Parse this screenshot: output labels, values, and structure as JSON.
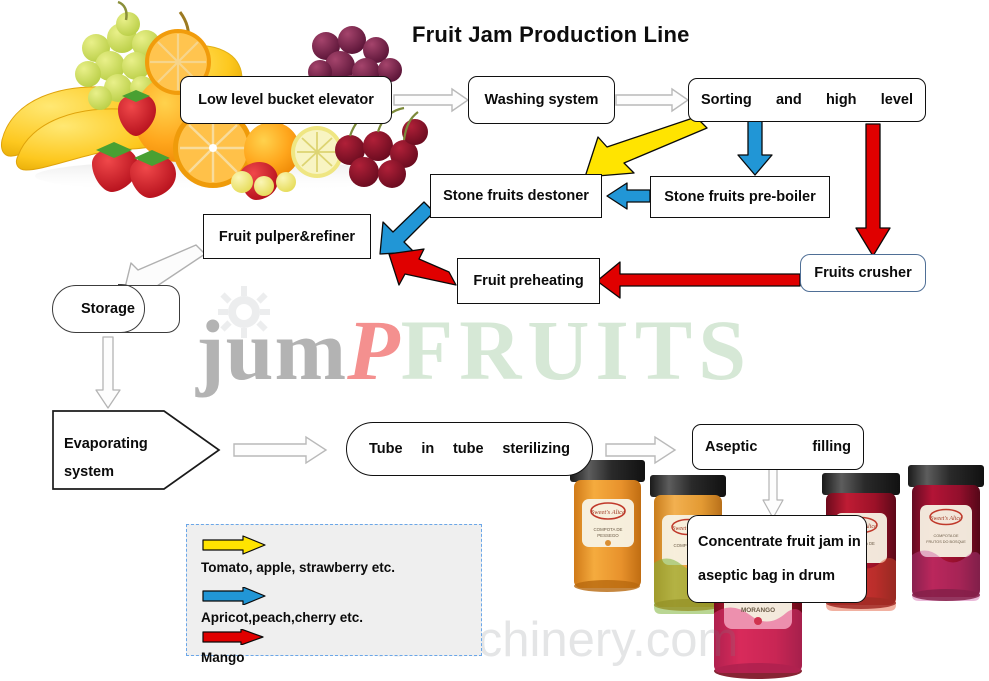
{
  "title": "Fruit Jam Production Line",
  "watermark": {
    "logo_part1": "jum",
    "logo_part2": "P",
    "logo_part3": "FRUITS",
    "url": "fr.fruitsmachinery.com",
    "logo_color1": "#b3b3b3",
    "logo_color2": "#f4908f",
    "logo_color3": "#cfe3cf"
  },
  "nodes": {
    "bucket_elevator": "Low level bucket elevator",
    "washing_system": "Washing system",
    "sorting_left": "Sorting",
    "sorting_mid1": "and",
    "sorting_mid2": "high",
    "sorting_right": "level",
    "stone_destoner": "Stone fruits destoner",
    "stone_preboiler": "Stone fruits pre-boiler",
    "pulper_refiner": "Fruit  pulper&refiner",
    "storage": "Storage",
    "fruit_preheating": "Fruit  preheating",
    "fruits_crusher": "Fruits crusher",
    "evaporating_line1": "Evaporating",
    "evaporating_line2": "system",
    "tube_l1": "Tube",
    "tube_l2": "in",
    "tube_l3": "tube",
    "tube_l4": "sterilizing",
    "aseptic_left": "Aseptic",
    "aseptic_right": "filling",
    "concentrate_line1": "Concentrate fruit jam in",
    "concentrate_line2": "aseptic bag in drum"
  },
  "legend": {
    "items": [
      {
        "label": "Tomato, apple, strawberry etc.",
        "color": "#ffe400"
      },
      {
        "label": "Apricot,peach,cherry etc.",
        "color": "#2196d6"
      },
      {
        "label": "Mango",
        "color": "#e00000"
      }
    ],
    "border_color": "#6aa6e8",
    "fill_color": "#efefef"
  },
  "arrow_colors": {
    "yellow": "#ffe400",
    "blue": "#2196d6",
    "red": "#e00000",
    "gray": "#9a9a9a"
  },
  "jars": [
    {
      "name": "apricot-jam-jar",
      "jam": "#e8922c",
      "label": "COMPOTA DE PESSEGO"
    },
    {
      "name": "peach-jam-jar",
      "jam": "#e39a33",
      "label": "COMPOTA DE"
    },
    {
      "name": "strawberry-jam-jar",
      "jam": "#a8122a",
      "label": "COMPOTA DE MORANGO"
    },
    {
      "name": "berry-jam-jar",
      "jam": "#9e1030",
      "label": "COMPOTA DE FRUTOS DO BOSQUE"
    },
    {
      "name": "front-strawberry-jam-jar",
      "jam": "#b5142c",
      "label": "COMPOTA DE MORANGO"
    }
  ]
}
